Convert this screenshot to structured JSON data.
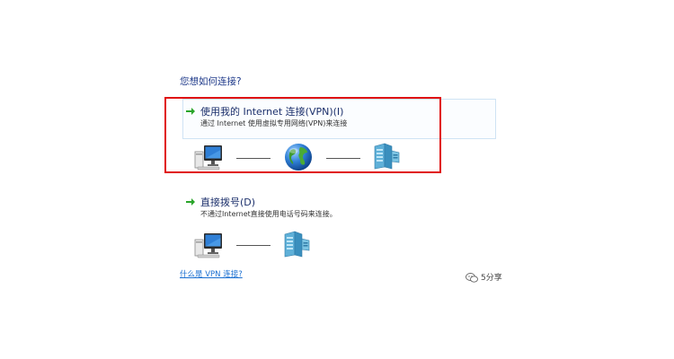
{
  "heading": "您想如何连接?",
  "options": [
    {
      "title": "使用我的 Internet 连接(VPN)(I)",
      "description": "通过 Internet 使用虚拟专用网络(VPN)来连接"
    },
    {
      "title": "直接拨号(D)",
      "description": "不通过Internet直接使用电话号码来连接。"
    }
  ],
  "help_link": "什么是 VPN 连接?",
  "watermark": "5分享",
  "colors": {
    "highlight_border": "#e01010",
    "heading_text": "#1f3a8a",
    "link": "#1a6fd1",
    "arrow_green": "#2aa52a"
  },
  "icons": {
    "option_arrow": "green-arrow-icon",
    "computer": "computer-icon",
    "globe": "globe-icon",
    "server": "server-icon",
    "watermark": "wechat-icon"
  }
}
